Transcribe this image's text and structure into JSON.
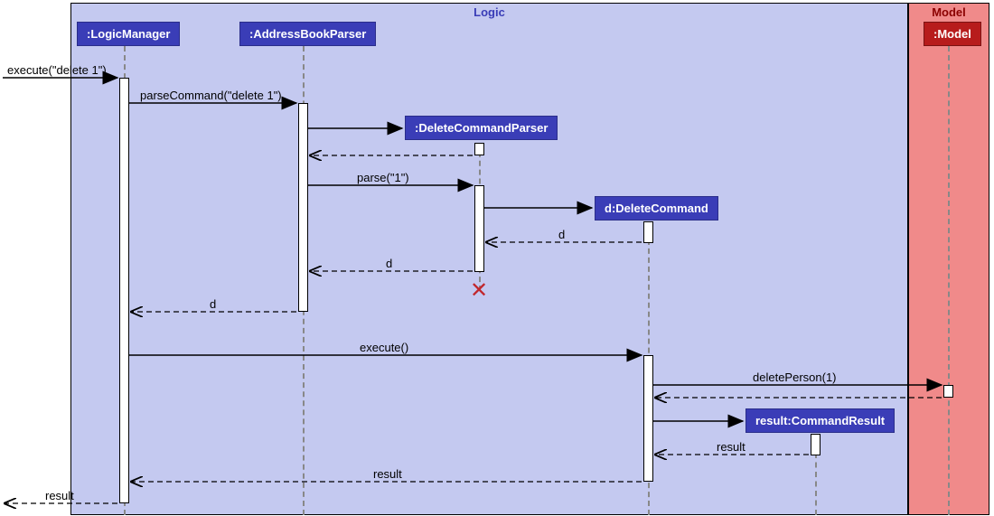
{
  "regions": {
    "logic": {
      "title": "Logic"
    },
    "model": {
      "title": "Model"
    }
  },
  "participants": {
    "logicManager": ":LogicManager",
    "addressBookParser": ":AddressBookParser",
    "deleteCommandParser": ":DeleteCommandParser",
    "deleteCommand": "d:DeleteCommand",
    "model": ":Model",
    "commandResult": "result:CommandResult"
  },
  "messages": {
    "executeDelete1": "execute(\"delete 1\")",
    "parseCommandDelete1": "parseCommand(\"delete 1\")",
    "parse1": "parse(\"1\")",
    "d1": "d",
    "d2": "d",
    "d3": "d",
    "executeEmpty": "execute()",
    "deletePerson1": "deletePerson(1)",
    "result1": "result",
    "result2": "result",
    "result3": "result"
  },
  "chart_data": {
    "type": "sequence_diagram",
    "regions": [
      {
        "name": "Logic",
        "participants": [
          ":LogicManager",
          ":AddressBookParser",
          ":DeleteCommandParser",
          "d:DeleteCommand",
          "result:CommandResult"
        ]
      },
      {
        "name": "Model",
        "participants": [
          ":Model"
        ]
      }
    ],
    "messages": [
      {
        "from": "(caller)",
        "to": ":LogicManager",
        "label": "execute(\"delete 1\")",
        "type": "sync"
      },
      {
        "from": ":LogicManager",
        "to": ":AddressBookParser",
        "label": "parseCommand(\"delete 1\")",
        "type": "sync"
      },
      {
        "from": ":AddressBookParser",
        "to": ":DeleteCommandParser",
        "label": "",
        "type": "create"
      },
      {
        "from": ":DeleteCommandParser",
        "to": ":AddressBookParser",
        "label": "",
        "type": "return"
      },
      {
        "from": ":AddressBookParser",
        "to": ":DeleteCommandParser",
        "label": "parse(\"1\")",
        "type": "sync"
      },
      {
        "from": ":DeleteCommandParser",
        "to": "d:DeleteCommand",
        "label": "",
        "type": "create"
      },
      {
        "from": "d:DeleteCommand",
        "to": ":DeleteCommandParser",
        "label": "d",
        "type": "return"
      },
      {
        "from": ":DeleteCommandParser",
        "to": ":AddressBookParser",
        "label": "d",
        "type": "return"
      },
      {
        "from": ":DeleteCommandParser",
        "to": "X",
        "label": "",
        "type": "destroy"
      },
      {
        "from": ":AddressBookParser",
        "to": ":LogicManager",
        "label": "d",
        "type": "return"
      },
      {
        "from": ":LogicManager",
        "to": "d:DeleteCommand",
        "label": "execute()",
        "type": "sync"
      },
      {
        "from": "d:DeleteCommand",
        "to": ":Model",
        "label": "deletePerson(1)",
        "type": "sync"
      },
      {
        "from": ":Model",
        "to": "d:DeleteCommand",
        "label": "",
        "type": "return"
      },
      {
        "from": "d:DeleteCommand",
        "to": "result:CommandResult",
        "label": "",
        "type": "create"
      },
      {
        "from": "result:CommandResult",
        "to": "d:DeleteCommand",
        "label": "result",
        "type": "return"
      },
      {
        "from": "d:DeleteCommand",
        "to": ":LogicManager",
        "label": "result",
        "type": "return"
      },
      {
        "from": ":LogicManager",
        "to": "(caller)",
        "label": "result",
        "type": "return"
      }
    ]
  }
}
